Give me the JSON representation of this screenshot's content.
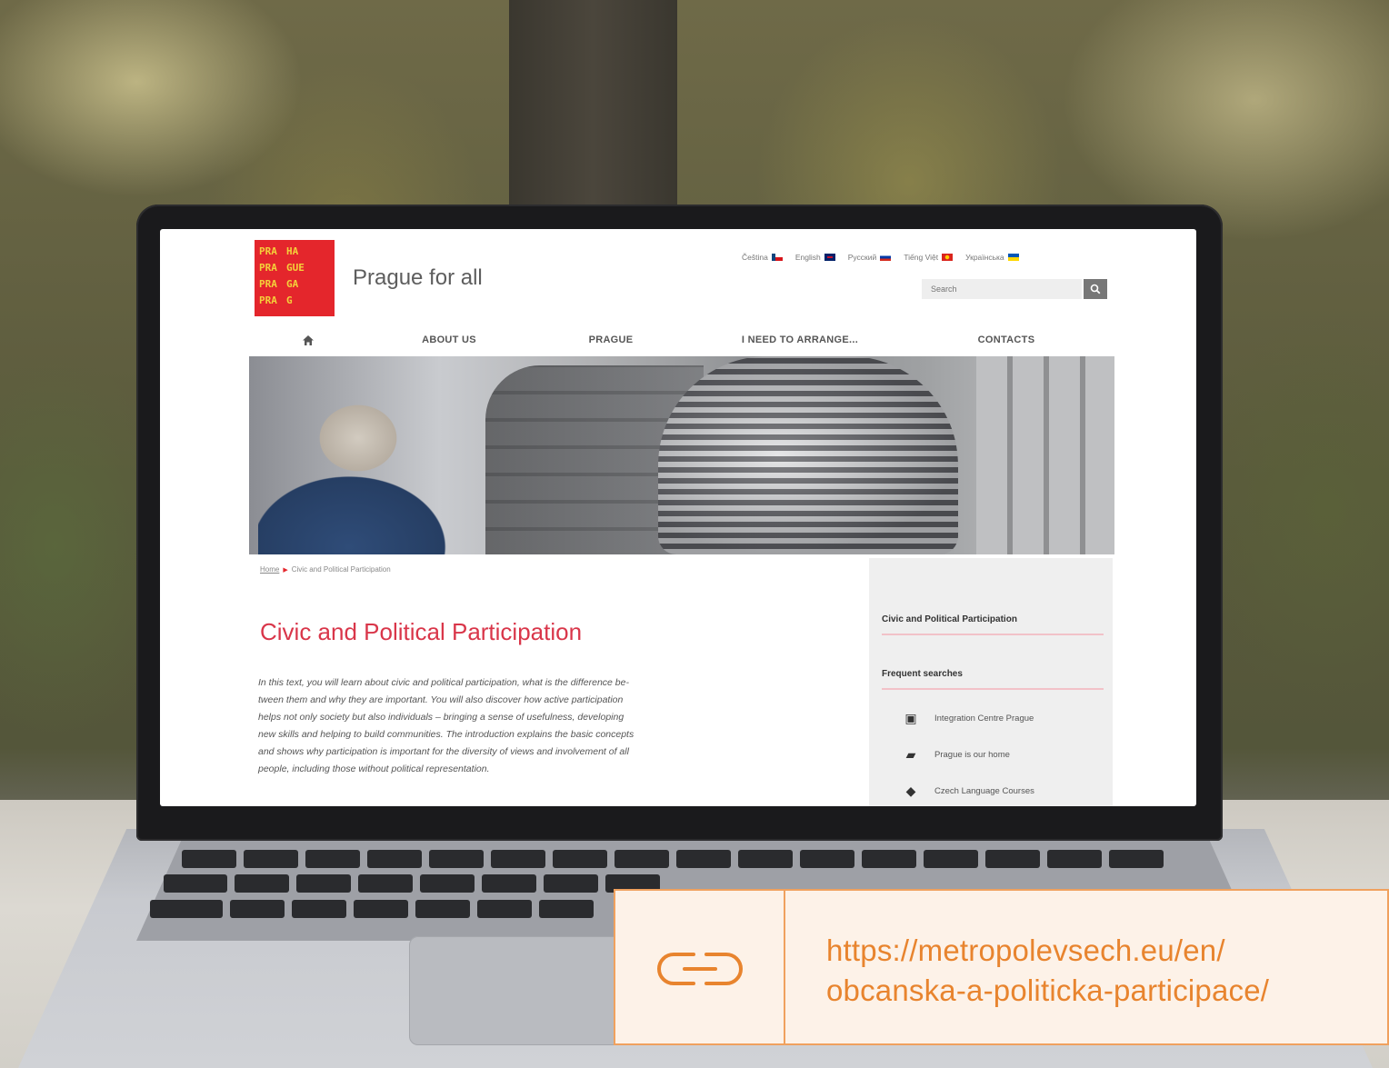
{
  "site": {
    "logo_lines": [
      [
        "PRA",
        "HA"
      ],
      [
        "PRA",
        "GUE"
      ],
      [
        "PRA",
        "GA"
      ],
      [
        "PRA",
        "G"
      ]
    ],
    "title": "Prague for all",
    "languages": [
      {
        "label": "Čeština",
        "flag": "cz"
      },
      {
        "label": "English",
        "flag": "gb"
      },
      {
        "label": "Русский",
        "flag": "ru"
      },
      {
        "label": "Tiếng Việt",
        "flag": "vn"
      },
      {
        "label": "Українська",
        "flag": "ua"
      }
    ],
    "search": {
      "placeholder": "Search"
    },
    "nav": [
      {
        "label": "",
        "icon": "home-icon"
      },
      {
        "label": "ABOUT US"
      },
      {
        "label": "PRAGUE",
        "active": true
      },
      {
        "label": "I NEED TO ARRANGE..."
      },
      {
        "label": "CONTACTS"
      }
    ],
    "breadcrumb": {
      "home": "Home",
      "current": "Civic and Political Participation"
    },
    "page_title": "Civic and Political Participation",
    "intro_lines": [
      "In this text, you will learn about civic and political participation, what is the difference be-",
      "tween them and why they are important. You will also discover how active participation",
      "helps not only society but also individuals – bringing a sense of usefulness, developing",
      "new skills and helping to build communities. The introduction explains the basic concepts",
      "and shows why participation is important for the diversity of views and involvement of all",
      "people, including those without political representation."
    ],
    "sidebar": {
      "section_title": "Civic and Political Participation",
      "frequent_title": "Frequent searches",
      "links": [
        {
          "label": "Integration Centre Prague",
          "icon": "building-icon"
        },
        {
          "label": "Prague is our home",
          "icon": "book-icon"
        },
        {
          "label": "Czech Language Courses",
          "icon": "graduation-cap-icon"
        }
      ]
    }
  },
  "banner": {
    "url_line1": "https://metropolevsech.eu/en/",
    "url_line2": "obcanska-a-politicka-participace/",
    "icon": "link-icon"
  },
  "colors": {
    "brand_red": "#e4262c",
    "title_red": "#d9364a",
    "banner_accent": "#e8842e",
    "banner_border": "#f0a15e",
    "banner_bg": "#fdf2e8"
  }
}
